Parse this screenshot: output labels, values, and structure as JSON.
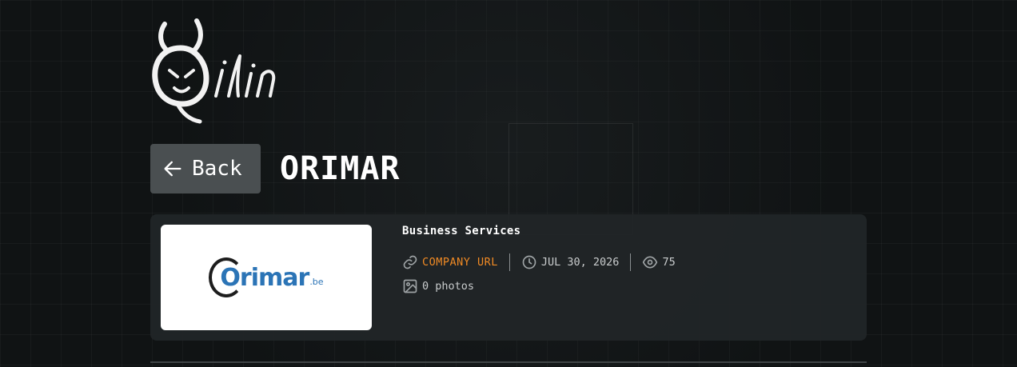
{
  "brand": {
    "logo_name": "Qilin"
  },
  "header": {
    "back_label": "Back",
    "title": "ORIMAR"
  },
  "card": {
    "image": {
      "logo_text": "Orimar",
      "logo_tld": ".be"
    },
    "category": "Business Services",
    "company_url_label": "COMPANY URL",
    "date": "JUL 30, 2026",
    "views": "75",
    "photos": "0 photos"
  },
  "colors": {
    "background": "#101314",
    "card": "#212527",
    "back_button": "#4a4f51",
    "accent": "#f08a24",
    "brand_blue": "#2b74b6"
  },
  "icons": [
    "arrow-left-icon",
    "link-icon",
    "clock-icon",
    "eye-icon",
    "image-icon"
  ]
}
